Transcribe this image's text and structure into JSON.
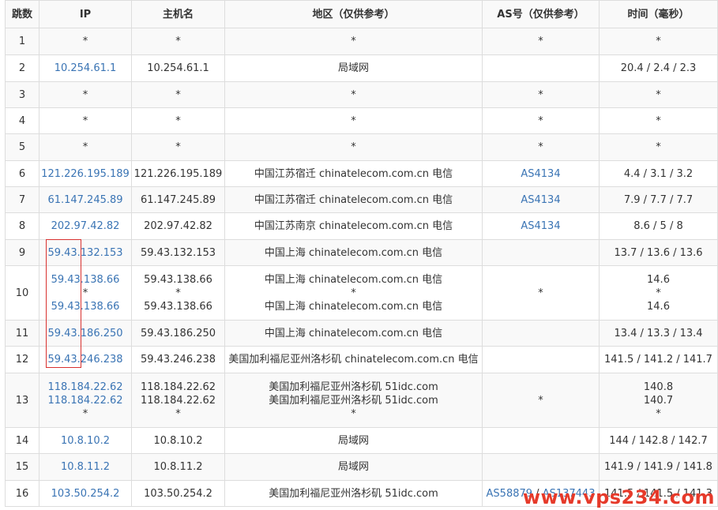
{
  "headers": [
    "跳数",
    "IP",
    "主机名",
    "地区（仅供参考）",
    "AS号（仅供参考）",
    "时间（毫秒）"
  ],
  "rows": [
    {
      "hop": "1",
      "ip": [
        "*"
      ],
      "host": [
        "*"
      ],
      "region": [
        "*"
      ],
      "as": [
        "*"
      ],
      "time": [
        "*"
      ]
    },
    {
      "hop": "2",
      "ip": [
        "10.254.61.1"
      ],
      "host": [
        "10.254.61.1"
      ],
      "region": [
        "局域网"
      ],
      "as": [],
      "time": [
        "20.4 / 2.4 / 2.3"
      ]
    },
    {
      "hop": "3",
      "ip": [
        "*"
      ],
      "host": [
        "*"
      ],
      "region": [
        "*"
      ],
      "as": [
        "*"
      ],
      "time": [
        "*"
      ]
    },
    {
      "hop": "4",
      "ip": [
        "*"
      ],
      "host": [
        "*"
      ],
      "region": [
        "*"
      ],
      "as": [
        "*"
      ],
      "time": [
        "*"
      ]
    },
    {
      "hop": "5",
      "ip": [
        "*"
      ],
      "host": [
        "*"
      ],
      "region": [
        "*"
      ],
      "as": [
        "*"
      ],
      "time": [
        "*"
      ]
    },
    {
      "hop": "6",
      "ip": [
        "121.226.195.189"
      ],
      "host": [
        "121.226.195.189"
      ],
      "region": [
        "中国江苏宿迁 chinatelecom.com.cn 电信"
      ],
      "as": [
        "AS4134"
      ],
      "time": [
        "4.4 / 3.1 / 3.2"
      ]
    },
    {
      "hop": "7",
      "ip": [
        "61.147.245.89"
      ],
      "host": [
        "61.147.245.89"
      ],
      "region": [
        "中国江苏宿迁 chinatelecom.com.cn 电信"
      ],
      "as": [
        "AS4134"
      ],
      "time": [
        "7.9 / 7.7 / 7.7"
      ]
    },
    {
      "hop": "8",
      "ip": [
        "202.97.42.82"
      ],
      "host": [
        "202.97.42.82"
      ],
      "region": [
        "中国江苏南京 chinatelecom.com.cn 电信"
      ],
      "as": [
        "AS4134"
      ],
      "time": [
        "8.6 / 5 / 8"
      ]
    },
    {
      "hop": "9",
      "ip": [
        "59.43.132.153"
      ],
      "host": [
        "59.43.132.153"
      ],
      "region": [
        "中国上海 chinatelecom.com.cn 电信"
      ],
      "as": [],
      "time": [
        "13.7 / 13.6 / 13.6"
      ]
    },
    {
      "hop": "10",
      "ip": [
        "59.43.138.66",
        "*",
        "59.43.138.66"
      ],
      "host": [
        "59.43.138.66",
        "*",
        "59.43.138.66"
      ],
      "region": [
        "中国上海 chinatelecom.com.cn 电信",
        "*",
        "中国上海 chinatelecom.com.cn 电信"
      ],
      "as": [
        "*"
      ],
      "time": [
        "14.6",
        "*",
        "14.6"
      ]
    },
    {
      "hop": "11",
      "ip": [
        "59.43.186.250"
      ],
      "host": [
        "59.43.186.250"
      ],
      "region": [
        "中国上海 chinatelecom.com.cn 电信"
      ],
      "as": [],
      "time": [
        "13.4 / 13.3 / 13.4"
      ]
    },
    {
      "hop": "12",
      "ip": [
        "59.43.246.238"
      ],
      "host": [
        "59.43.246.238"
      ],
      "region": [
        "美国加利福尼亚州洛杉矶 chinatelecom.com.cn 电信"
      ],
      "as": [],
      "time": [
        "141.5 / 141.2 / 141.7"
      ]
    },
    {
      "hop": "13",
      "ip": [
        "118.184.22.62",
        "118.184.22.62",
        "*"
      ],
      "host": [
        "118.184.22.62",
        "118.184.22.62",
        "*"
      ],
      "region": [
        "美国加利福尼亚州洛杉矶 51idc.com",
        "美国加利福尼亚州洛杉矶 51idc.com",
        "*"
      ],
      "as": [
        "*"
      ],
      "time": [
        "140.8",
        "140.7",
        "*"
      ]
    },
    {
      "hop": "14",
      "ip": [
        "10.8.10.2"
      ],
      "host": [
        "10.8.10.2"
      ],
      "region": [
        "局域网"
      ],
      "as": [],
      "time": [
        "144 / 142.8 / 142.7"
      ]
    },
    {
      "hop": "15",
      "ip": [
        "10.8.11.2"
      ],
      "host": [
        "10.8.11.2"
      ],
      "region": [
        "局域网"
      ],
      "as": [],
      "time": [
        "141.9 / 141.9 / 141.8"
      ]
    },
    {
      "hop": "16",
      "ip": [
        "103.50.254.2"
      ],
      "host": [
        "103.50.254.2"
      ],
      "region": [
        "美国加利福尼亚州洛杉矶 51idc.com"
      ],
      "as": [
        "AS58879",
        "AS137443"
      ],
      "as_separator": " / ",
      "time": [
        "141.5 / 141.5 / 141.3"
      ]
    }
  ],
  "row_heights": [
    34,
    34,
    33,
    33,
    34,
    33,
    33,
    34,
    33,
    69,
    33,
    34,
    69,
    33,
    34,
    33
  ],
  "watermark": "www.vps234.com",
  "colors": {
    "link": "#3a74b4",
    "highlight": "#d9312f",
    "watermark": "#e63a2a"
  }
}
